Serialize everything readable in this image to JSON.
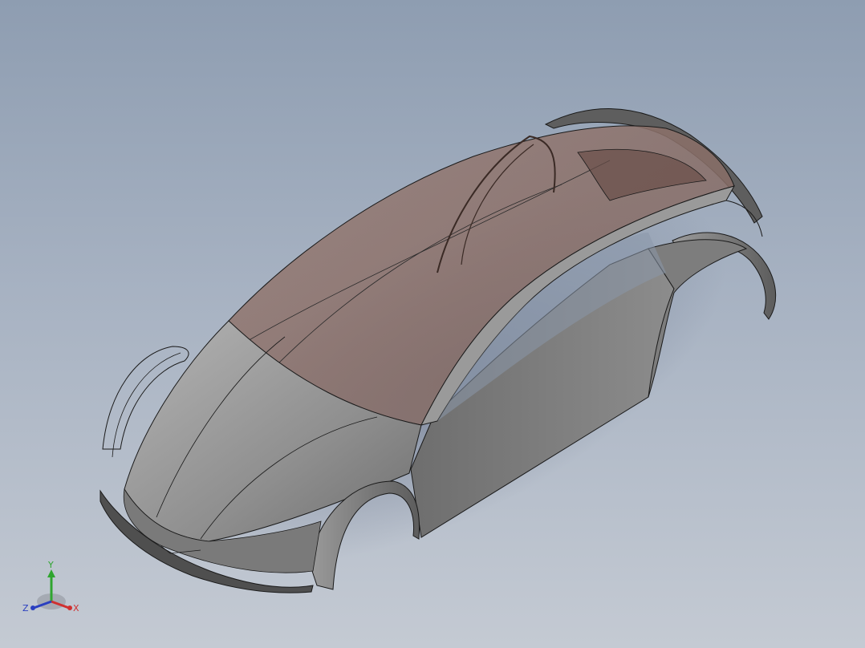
{
  "viewport": {
    "background_top": "#8e9db1",
    "background_bottom": "#c4cad3"
  },
  "model": {
    "body_color": "#8d8d8d",
    "glass_color": "#8a6f68",
    "edge_color": "#1a1a1a"
  },
  "triad": {
    "x_label": "X",
    "y_label": "Y",
    "z_label": "Z",
    "x_color": "#d03030",
    "y_color": "#2fa52f",
    "z_color": "#2a3fc0"
  }
}
